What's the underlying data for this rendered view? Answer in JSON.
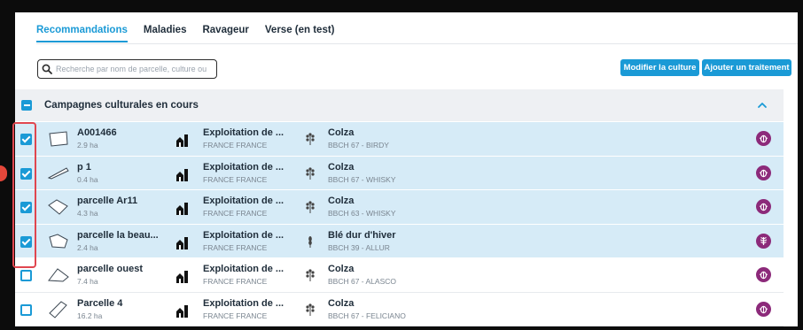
{
  "tabs": [
    {
      "label": "Recommandations",
      "active": true
    },
    {
      "label": "Maladies",
      "active": false
    },
    {
      "label": "Ravageur",
      "active": false
    },
    {
      "label": "Verse (en test)",
      "active": false
    }
  ],
  "search": {
    "placeholder": "Recherche par nom de parcelle, culture ou"
  },
  "buttons": {
    "modifier": "Modifier la culture",
    "ajouter": "Ajouter un traitement"
  },
  "campaign": {
    "title": "Campagnes culturales en cours",
    "expanded": true
  },
  "colors": {
    "accent": "#1a9ad6",
    "selected_row": "#d6ebf7",
    "pest_badge": "#8c2a7a",
    "highlight": "#e0464f"
  },
  "rows": [
    {
      "name": "A001466",
      "area": "2.9 ha",
      "exploitation": "Exploitation de ...",
      "country": "FRANCE FRANCE",
      "crop": "Colza",
      "stage": "BBCH 67 - BIRDY",
      "crop_icon": "rapeseed-icon",
      "pest_icon": "bug-icon",
      "selected": true
    },
    {
      "name": "p 1",
      "area": "0.4 ha",
      "exploitation": "Exploitation de ...",
      "country": "FRANCE FRANCE",
      "crop": "Colza",
      "stage": "BBCH 67 - WHISKY",
      "crop_icon": "rapeseed-icon",
      "pest_icon": "bug-icon",
      "selected": true
    },
    {
      "name": "parcelle Ar11",
      "area": "4.3 ha",
      "exploitation": "Exploitation de ...",
      "country": "FRANCE FRANCE",
      "crop": "Colza",
      "stage": "BBCH 63 - WHISKY",
      "crop_icon": "rapeseed-icon",
      "pest_icon": "bug-icon",
      "selected": true
    },
    {
      "name": "parcelle la beau...",
      "area": "2.4 ha",
      "exploitation": "Exploitation de ...",
      "country": "FRANCE FRANCE",
      "crop": "Blé dur d'hiver",
      "stage": "BBCH 39 - ALLUR",
      "crop_icon": "wheat-icon",
      "pest_icon": "wheat-pest-icon",
      "selected": true
    },
    {
      "name": "parcelle ouest",
      "area": "7.4 ha",
      "exploitation": "Exploitation de ...",
      "country": "FRANCE FRANCE",
      "crop": "Colza",
      "stage": "BBCH 67 - ALASCO",
      "crop_icon": "rapeseed-icon",
      "pest_icon": "bug-icon",
      "selected": false
    },
    {
      "name": "Parcelle 4",
      "area": "16.2 ha",
      "exploitation": "Exploitation de ...",
      "country": "FRANCE FRANCE",
      "crop": "Colza",
      "stage": "BBCH 67 - FELICIANO",
      "crop_icon": "rapeseed-icon",
      "pest_icon": "bug-icon",
      "selected": false
    }
  ]
}
